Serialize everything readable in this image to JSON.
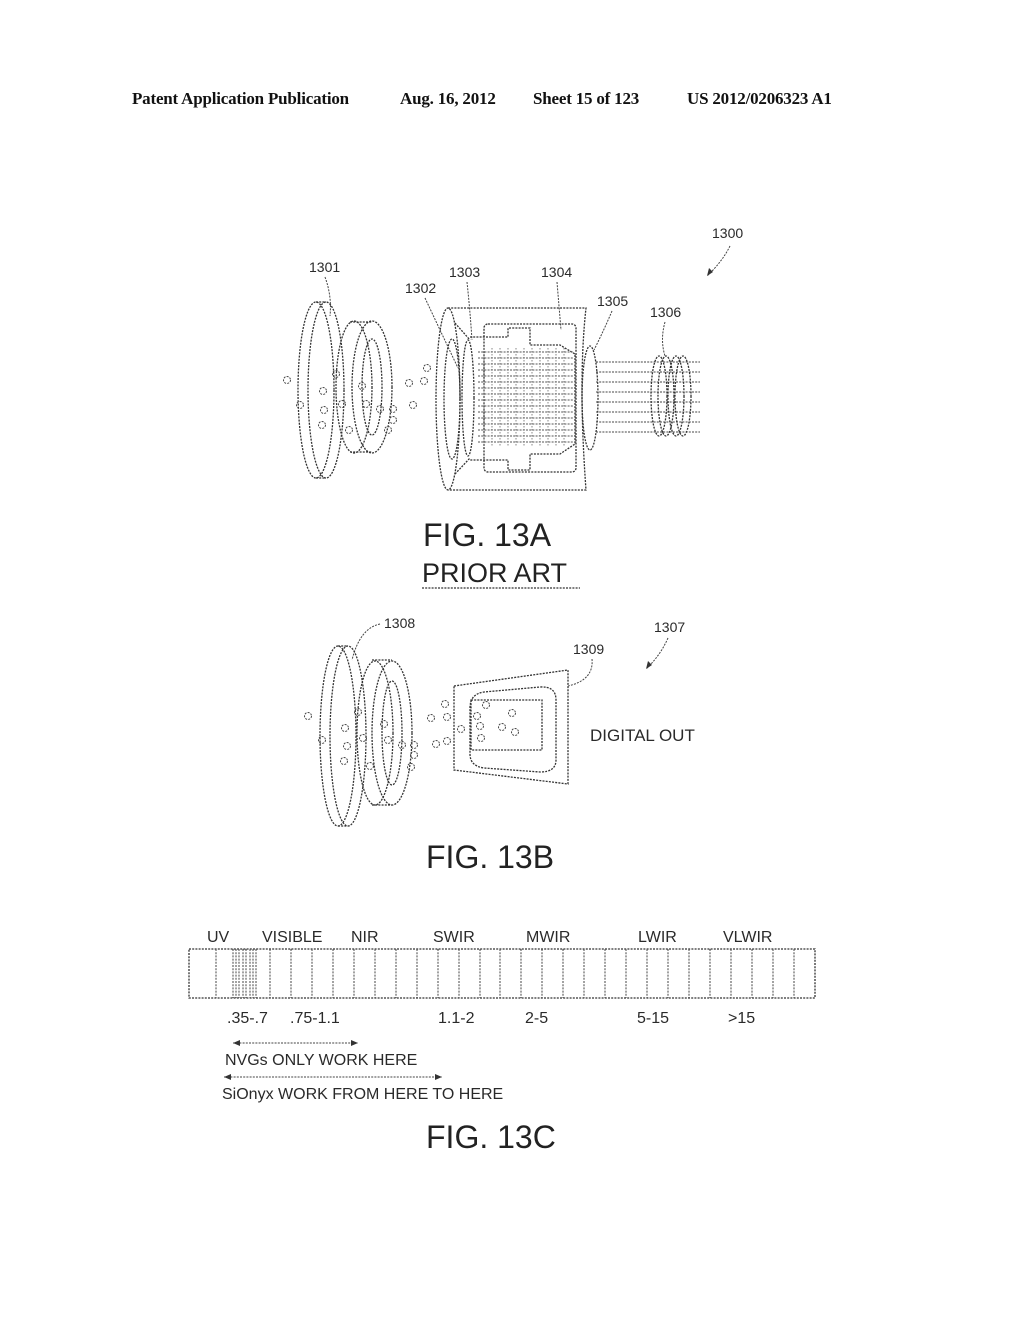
{
  "header": {
    "publication_type": "Patent Application Publication",
    "date": "Aug. 16, 2012",
    "sheet": "Sheet 15 of 123",
    "publication_number": "US 2012/0206323 A1"
  },
  "fig13a": {
    "caption": "FIG. 13A",
    "subcaption": "PRIOR ART",
    "refs": {
      "assembly": "1300",
      "lens": "1301",
      "window": "1302",
      "photocathode": "1303",
      "tube": "1304",
      "screen": "1305",
      "eyepiece": "1306"
    }
  },
  "fig13b": {
    "caption": "FIG. 13B",
    "refs": {
      "assembly": "1307",
      "lens": "1308",
      "sensor": "1309"
    },
    "output_label": "DIGITAL OUT"
  },
  "fig13c": {
    "caption": "FIG. 13C",
    "bands": [
      {
        "name": "UV",
        "range": ""
      },
      {
        "name": "VISIBLE",
        "range": ".35-.7"
      },
      {
        "name": "NIR",
        "range": ".75-1.1"
      },
      {
        "name": "SWIR",
        "range": "1.1-2"
      },
      {
        "name": "MWIR",
        "range": "2-5"
      },
      {
        "name": "LWIR",
        "range": "5-15"
      },
      {
        "name": "VLWIR",
        "range": ">15"
      }
    ],
    "arrows": [
      {
        "label": "NVGs ONLY WORK HERE"
      },
      {
        "label": "SiOnyx WORK FROM HERE TO HERE"
      }
    ]
  }
}
